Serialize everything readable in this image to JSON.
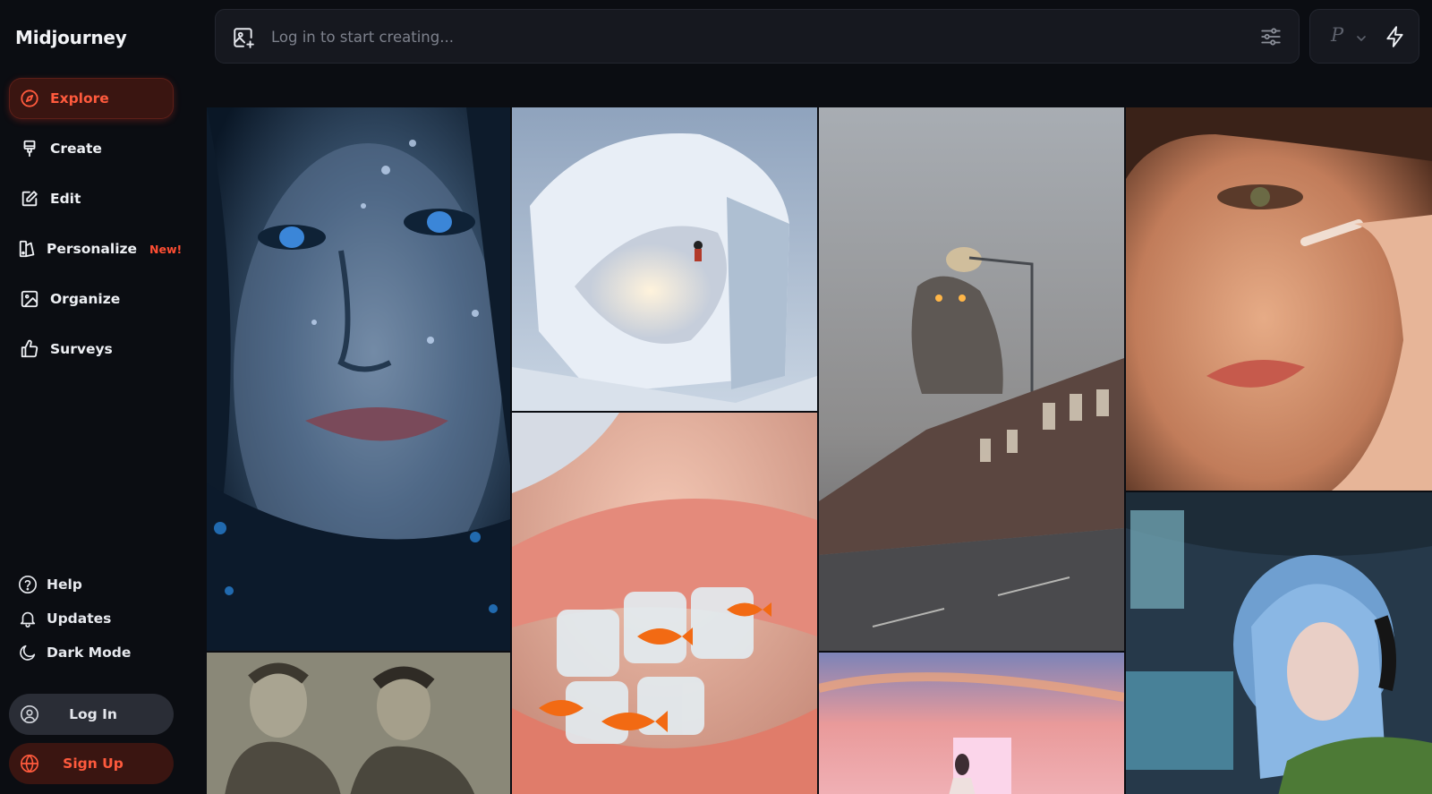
{
  "app": {
    "brand": "Midjourney"
  },
  "sidebar": {
    "nav": [
      {
        "label": "Explore",
        "icon": "compass-icon",
        "active": true
      },
      {
        "label": "Create",
        "icon": "brush-icon"
      },
      {
        "label": "Edit",
        "icon": "edit-icon"
      },
      {
        "label": "Personalize",
        "icon": "personalize-icon",
        "badge": "New!"
      },
      {
        "label": "Organize",
        "icon": "image-folder-icon"
      },
      {
        "label": "Surveys",
        "icon": "thumbs-up-icon"
      }
    ],
    "utility": [
      {
        "label": "Help",
        "icon": "help-icon"
      },
      {
        "label": "Updates",
        "icon": "bell-icon"
      },
      {
        "label": "Dark Mode",
        "icon": "moon-icon"
      }
    ],
    "login_label": "Log In",
    "signup_label": "Sign Up"
  },
  "prompt": {
    "placeholder": "Log in to start creating..."
  },
  "controls": {
    "profile_letter": "P"
  },
  "colors": {
    "accent": "#ff5a3d",
    "background": "#0b0d12",
    "panel": "#16181f"
  },
  "gallery": [
    {
      "subject": "woman face with water droplets, blue light"
    },
    {
      "subject": "snowboarder on snow wave cube"
    },
    {
      "subject": "giant owl over foggy street with lamp"
    },
    {
      "subject": "woman face close-up with cream"
    },
    {
      "subject": "two men in fur coats, vintage photo"
    },
    {
      "subject": "lips with goldfish and ice cubes"
    },
    {
      "subject": "anime girl with headphones at computers"
    },
    {
      "subject": "pink sunset sky with glowing door and figure"
    }
  ]
}
